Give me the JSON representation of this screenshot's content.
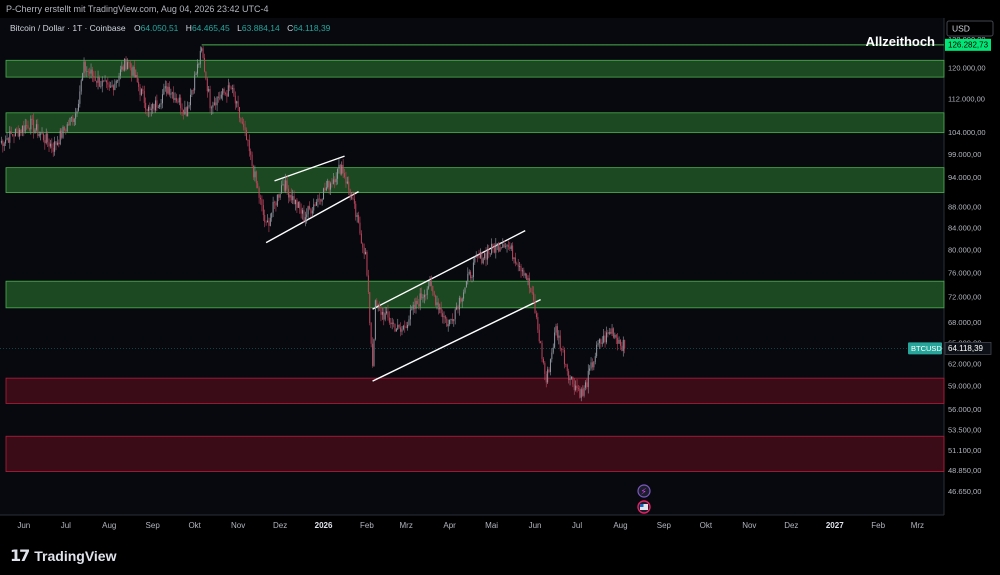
{
  "header": {
    "creator_text": "P-Cherry erstellt mit TradingView.com, Aug 04, 2026 23:42 UTC-4"
  },
  "legend": {
    "symbol": "Bitcoin / Dollar · 1T · Coinbase",
    "o_label": "O",
    "o_value": "64.050,51",
    "h_label": "H",
    "h_value": "64.465,45",
    "l_label": "L",
    "l_value": "63.884,14",
    "c_label": "C",
    "c_value": "64.118,39"
  },
  "currency_badge": "USD",
  "annotation": "Allzeithoch",
  "ath_price_label": "126.282,73",
  "last_price": {
    "ticker": "BTCUSD",
    "price": "64.118,39"
  },
  "footer": {
    "brand": "TradingView"
  },
  "colors": {
    "background": "#000000",
    "panel": "#07090f",
    "candle_up": "#9598a1",
    "candle_down": "#c2455d",
    "zone_green": "#2e7d32",
    "zone_red": "#6b1020",
    "zone_border_green": "#4caf50",
    "zone_border_red": "#b71c3a",
    "ath_badge": "#00e676",
    "channel_line": "#ffffff"
  },
  "chart_data": {
    "type": "candlestick",
    "x_range": [
      "2025-05-15",
      "2027-03-20"
    ],
    "x_ticks": [
      {
        "label": "Jun",
        "date": "2025-06-01"
      },
      {
        "label": "Jul",
        "date": "2025-07-01"
      },
      {
        "label": "Aug",
        "date": "2025-08-01"
      },
      {
        "label": "Sep",
        "date": "2025-09-01"
      },
      {
        "label": "Okt",
        "date": "2025-10-01"
      },
      {
        "label": "Nov",
        "date": "2025-11-01"
      },
      {
        "label": "Dez",
        "date": "2025-12-01"
      },
      {
        "label": "2026",
        "date": "2026-01-01",
        "bold": true
      },
      {
        "label": "Feb",
        "date": "2026-02-01"
      },
      {
        "label": "Mrz",
        "date": "2026-03-01"
      },
      {
        "label": "Apr",
        "date": "2026-04-01"
      },
      {
        "label": "Mai",
        "date": "2026-05-01"
      },
      {
        "label": "Jun",
        "date": "2026-06-01"
      },
      {
        "label": "Jul",
        "date": "2026-07-01"
      },
      {
        "label": "Aug",
        "date": "2026-08-01"
      },
      {
        "label": "Sep",
        "date": "2026-09-01"
      },
      {
        "label": "Okt",
        "date": "2026-10-01"
      },
      {
        "label": "Nov",
        "date": "2026-11-01"
      },
      {
        "label": "Dez",
        "date": "2026-12-01"
      },
      {
        "label": "2027",
        "date": "2027-01-01",
        "bold": true
      },
      {
        "label": "Feb",
        "date": "2027-02-01"
      },
      {
        "label": "Mrz",
        "date": "2027-03-01"
      }
    ],
    "y_scale": "log",
    "y_range": [
      44500,
      132000
    ],
    "y_ticks": [
      {
        "label": "128.000,00",
        "value": 128000
      },
      {
        "label": "120.000,00",
        "value": 120000
      },
      {
        "label": "112.000,00",
        "value": 112000
      },
      {
        "label": "104.000,00",
        "value": 104000
      },
      {
        "label": "99.000,00",
        "value": 99000
      },
      {
        "label": "94.000,00",
        "value": 94000
      },
      {
        "label": "88.000,00",
        "value": 88000
      },
      {
        "label": "84.000,00",
        "value": 84000
      },
      {
        "label": "80.000,00",
        "value": 80000
      },
      {
        "label": "76.000,00",
        "value": 76000
      },
      {
        "label": "72.000,00",
        "value": 72000
      },
      {
        "label": "68.000,00",
        "value": 68000
      },
      {
        "label": "65.000,00",
        "value": 65000
      },
      {
        "label": "62.000,00",
        "value": 62000
      },
      {
        "label": "59.000,00",
        "value": 59000
      },
      {
        "label": "56.000,00",
        "value": 56000
      },
      {
        "label": "53.500,00",
        "value": 53500
      },
      {
        "label": "51.100,00",
        "value": 51100
      },
      {
        "label": "48.850,00",
        "value": 48850
      },
      {
        "label": "46.650,00",
        "value": 46650
      }
    ],
    "ath": {
      "date": "2025-10-06",
      "price": 126282.73
    },
    "last_price": 64118.39,
    "zones": [
      {
        "kind": "resistance",
        "low": 117500,
        "high": 122000
      },
      {
        "kind": "resistance",
        "low": 103800,
        "high": 108500
      },
      {
        "kind": "resistance",
        "low": 90800,
        "high": 96000
      },
      {
        "kind": "resistance",
        "low": 70200,
        "high": 74500
      },
      {
        "kind": "support",
        "low": 56700,
        "high": 60000
      },
      {
        "kind": "support",
        "low": 48700,
        "high": 52700
      }
    ],
    "channels": [
      {
        "name": "bear-flag-1",
        "lines": [
          {
            "from": [
              "2025-11-27",
              93200
            ],
            "to": [
              "2026-01-16",
              98500
            ]
          },
          {
            "from": [
              "2025-11-21",
              81200
            ],
            "to": [
              "2026-01-26",
              91000
            ]
          }
        ]
      },
      {
        "name": "bear-flag-2",
        "lines": [
          {
            "from": [
              "2026-02-05",
              70000
            ],
            "to": [
              "2026-05-25",
              83400
            ]
          },
          {
            "from": [
              "2026-02-05",
              59600
            ],
            "to": [
              "2026-06-05",
              71500
            ]
          }
        ]
      }
    ],
    "anchors": [
      [
        "2025-05-15",
        101500
      ],
      [
        "2025-06-05",
        106000
      ],
      [
        "2025-06-22",
        100500
      ],
      [
        "2025-07-08",
        108500
      ],
      [
        "2025-07-14",
        120000
      ],
      [
        "2025-08-01",
        114000
      ],
      [
        "2025-08-14",
        122000
      ],
      [
        "2025-08-30",
        108500
      ],
      [
        "2025-09-12",
        115000
      ],
      [
        "2025-09-25",
        109000
      ],
      [
        "2025-10-06",
        124500
      ],
      [
        "2025-10-12",
        111000
      ],
      [
        "2025-10-27",
        114500
      ],
      [
        "2025-11-07",
        102000
      ],
      [
        "2025-11-21",
        84000
      ],
      [
        "2025-12-03",
        93000
      ],
      [
        "2025-12-18",
        86000
      ],
      [
        "2026-01-05",
        92500
      ],
      [
        "2026-01-14",
        96500
      ],
      [
        "2026-01-22",
        88500
      ],
      [
        "2026-01-31",
        79000
      ],
      [
        "2026-02-05",
        62000
      ],
      [
        "2026-02-07",
        70500
      ],
      [
        "2026-02-25",
        66500
      ],
      [
        "2026-03-17",
        74000
      ],
      [
        "2026-03-31",
        67500
      ],
      [
        "2026-04-20",
        78000
      ],
      [
        "2026-05-10",
        81500
      ],
      [
        "2026-05-25",
        76000
      ],
      [
        "2026-05-31",
        71000
      ],
      [
        "2026-06-09",
        59500
      ],
      [
        "2026-06-16",
        67000
      ],
      [
        "2026-06-26",
        60000
      ],
      [
        "2026-07-05",
        57800
      ],
      [
        "2026-07-16",
        64500
      ],
      [
        "2026-07-26",
        66800
      ],
      [
        "2026-08-04",
        64118
      ]
    ]
  }
}
